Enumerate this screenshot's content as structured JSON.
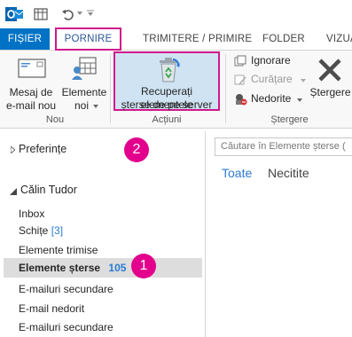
{
  "tabs": {
    "file": "FIȘIER",
    "home": "PORNIRE",
    "send_receive": "TRIMITERE / PRIMIRE",
    "folder": "FOLDER",
    "view": "VIZUA"
  },
  "ribbon": {
    "new_email": [
      "Mesaj de",
      "e-mail nou"
    ],
    "new_items": [
      "Elemente",
      "noi"
    ],
    "group_new": "Nou",
    "recover": [
      "Recuperați elementele",
      "șterse de pe server"
    ],
    "group_actions": "Acțiuni",
    "ignore": "Ignorare",
    "cleanup": "Curățare",
    "junk": "Nedorite",
    "delete": "Ștergere",
    "group_delete": "Ștergere"
  },
  "folders": {
    "favorites": "Preferințe",
    "account": "Călin Tudor",
    "items": [
      {
        "label": "Inbox",
        "count": ""
      },
      {
        "label": "Schițe",
        "count": "[3]"
      },
      {
        "label": "Elemente trimise",
        "count": ""
      },
      {
        "label": "Elemente șterse",
        "count": "105"
      },
      {
        "label": "E-mailuri secundare",
        "count": ""
      },
      {
        "label": "E-mail nedorit",
        "count": ""
      },
      {
        "label": "E-mailuri secundare",
        "count": ""
      }
    ]
  },
  "mail": {
    "search_placeholder": "Căutare în Elemente șterse (",
    "filter_all": "Toate",
    "filter_unread": "Necitite"
  },
  "callouts": {
    "one": "1",
    "two": "2"
  },
  "colors": {
    "accent": "#0072c6",
    "highlight": "#d0188c",
    "badge": "#e3008c",
    "count": "#2b7bd5"
  }
}
